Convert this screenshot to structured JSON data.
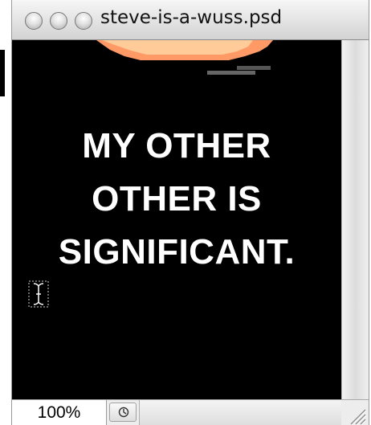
{
  "window": {
    "title": "steve-is-a-wuss.psd"
  },
  "canvas": {
    "caption_lines": [
      "MY OTHER",
      "OTHER IS",
      "SIGNIFICANT."
    ],
    "background_color": "#000000",
    "text_color": "#ffffff",
    "art_colors": [
      "#ff9966",
      "#ffcc99",
      "#666666"
    ],
    "cursor_icon": "text-insertion-cursor-icon"
  },
  "statusbar": {
    "zoom_level": "100%",
    "info_button_icon": "document-info-arrow-icon"
  }
}
